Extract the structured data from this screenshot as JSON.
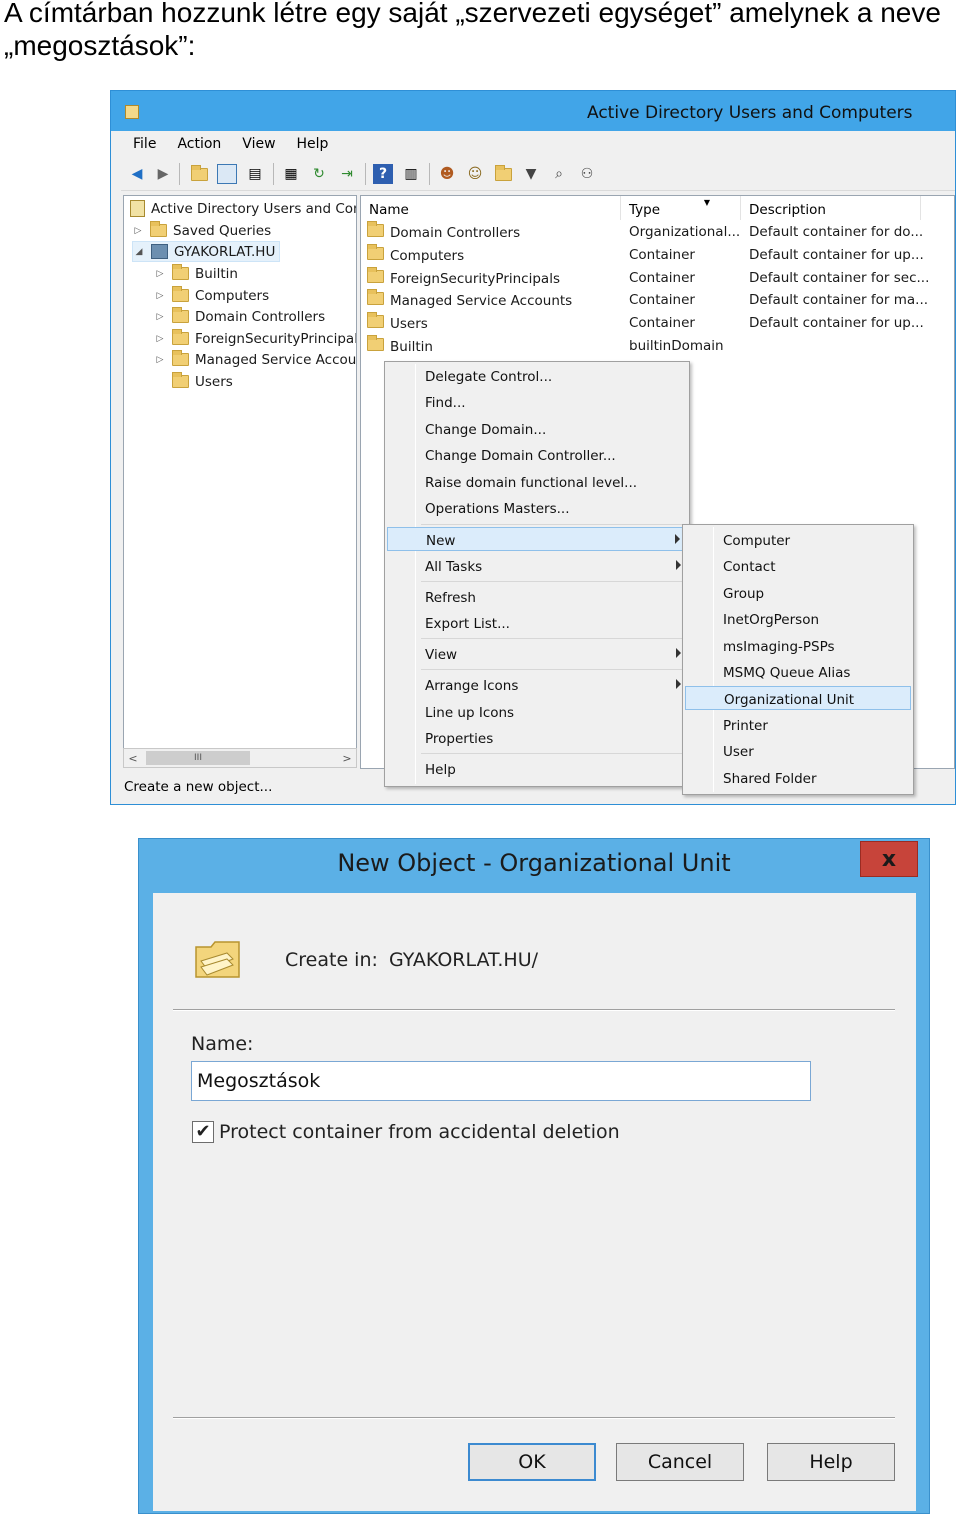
{
  "heading": "A címtárban hozzunk létre egy saját „szervezeti egységet” amelynek a neve „megosztások”:",
  "aduc": {
    "window_title": "Active Directory Users and Computers",
    "menu": [
      "File",
      "Action",
      "View",
      "Help"
    ],
    "tree": {
      "root": "Active Directory Users and Com",
      "saved_queries": "Saved Queries",
      "domain": "GYAKORLAT.HU",
      "children": [
        "Builtin",
        "Computers",
        "Domain Controllers",
        "ForeignSecurityPrincipals",
        "Managed Service Accour",
        "Users"
      ]
    },
    "scroll_thumb": "III",
    "status": "Create a new object...",
    "list": {
      "headers": [
        "Name",
        "Type",
        "Description"
      ],
      "rows": [
        {
          "name": "Domain Controllers",
          "type": "Organizational...",
          "desc": "Default container for do..."
        },
        {
          "name": "Computers",
          "type": "Container",
          "desc": "Default container for up..."
        },
        {
          "name": "ForeignSecurityPrincipals",
          "type": "Container",
          "desc": "Default container for sec..."
        },
        {
          "name": "Managed Service Accounts",
          "type": "Container",
          "desc": "Default container for ma..."
        },
        {
          "name": "Users",
          "type": "Container",
          "desc": "Default container for up..."
        },
        {
          "name": "Builtin",
          "type": "builtinDomain",
          "desc": ""
        }
      ]
    },
    "context_menu": [
      "Delegate Control...",
      "Find...",
      "Change Domain...",
      "Change Domain Controller...",
      "Raise domain functional level...",
      "Operations Masters...",
      "New",
      "All Tasks",
      "Refresh",
      "Export List...",
      "View",
      "Arrange Icons",
      "Line up Icons",
      "Properties",
      "Help"
    ],
    "submenu": [
      "Computer",
      "Contact",
      "Group",
      "InetOrgPerson",
      "msImaging-PSPs",
      "MSMQ Queue Alias",
      "Organizational Unit",
      "Printer",
      "User",
      "Shared Folder"
    ]
  },
  "dialog": {
    "title": "New Object - Organizational Unit",
    "close": "x",
    "create_in_label": "Create in:",
    "create_in_value": "GYAKORLAT.HU/",
    "name_label": "Name:",
    "name_value": "Megosztások",
    "checkbox_label": "Protect container from accidental deletion",
    "checkbox_checked": true,
    "check_mark": "✔",
    "buttons": {
      "ok": "OK",
      "cancel": "Cancel",
      "help": "Help"
    }
  },
  "colors": {
    "title_blue": "#41a5e8",
    "dialog_blue": "#5bb0e6",
    "close_red": "#c7443a",
    "highlight": "#dbecfb"
  }
}
